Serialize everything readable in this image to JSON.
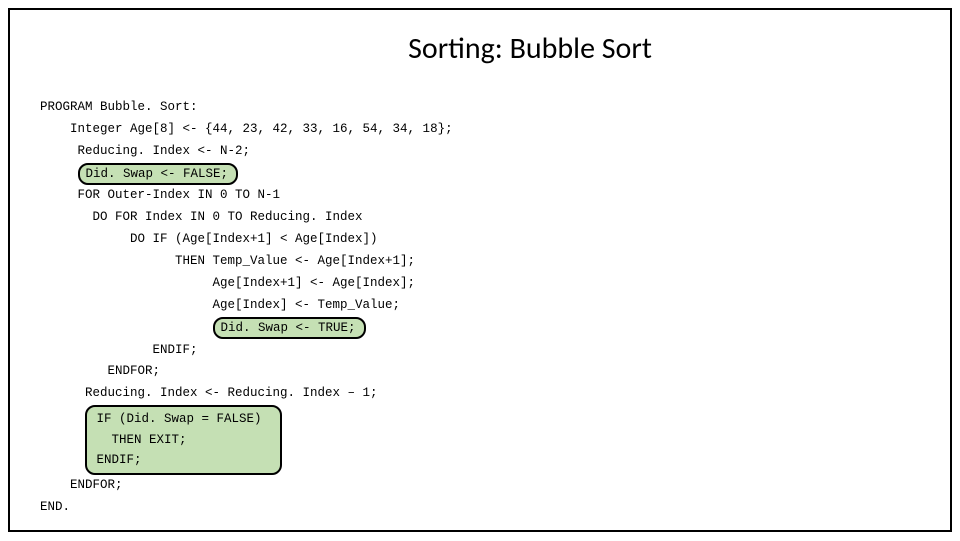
{
  "title": "Sorting: Bubble Sort",
  "code": {
    "l1": "PROGRAM Bubble. Sort:",
    "l2": "    Integer Age[8] <- {44, 23, 42, 33, 16, 54, 34, 18};",
    "l3": "     Reducing. Index <- N-2;",
    "l4_hl": "Did. Swap <- FALSE;",
    "l5": "     FOR Outer-Index IN 0 TO N-1",
    "l6": "       DO FOR Index IN 0 TO Reducing. Index",
    "l7": "            DO IF (Age[Index+1] < Age[Index])",
    "l8": "                  THEN Temp_Value <- Age[Index+1];",
    "l9": "                       Age[Index+1] <- Age[Index];",
    "l10": "                       Age[Index] <- Temp_Value;",
    "l11_hl": "Did. Swap <- TRUE;",
    "l12": "               ENDIF;",
    "l13": "         ENDFOR;",
    "l14": "      Reducing. Index <- Reducing. Index – 1;",
    "l15_hl_a": " IF (Did. Swap = FALSE)",
    "l15_hl_b": "   THEN EXIT;",
    "l15_hl_c": " ENDIF;",
    "l16": "    ENDFOR;",
    "l17": "END."
  }
}
